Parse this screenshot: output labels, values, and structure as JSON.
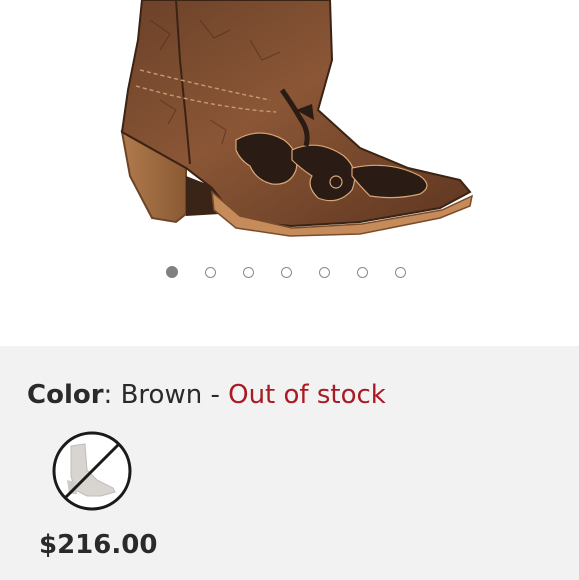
{
  "product": {
    "image_icon": "cowboy-boot-image",
    "carousel": {
      "total": 7,
      "active_index": 0
    }
  },
  "color": {
    "label": "Color",
    "separator": ": ",
    "value": "Brown",
    "dash": " - ",
    "status": "Out of stock",
    "status_color": "#a81b24"
  },
  "swatch": {
    "icon": "boot-swatch-unavailable-icon",
    "available": false
  },
  "price": "$216.00"
}
